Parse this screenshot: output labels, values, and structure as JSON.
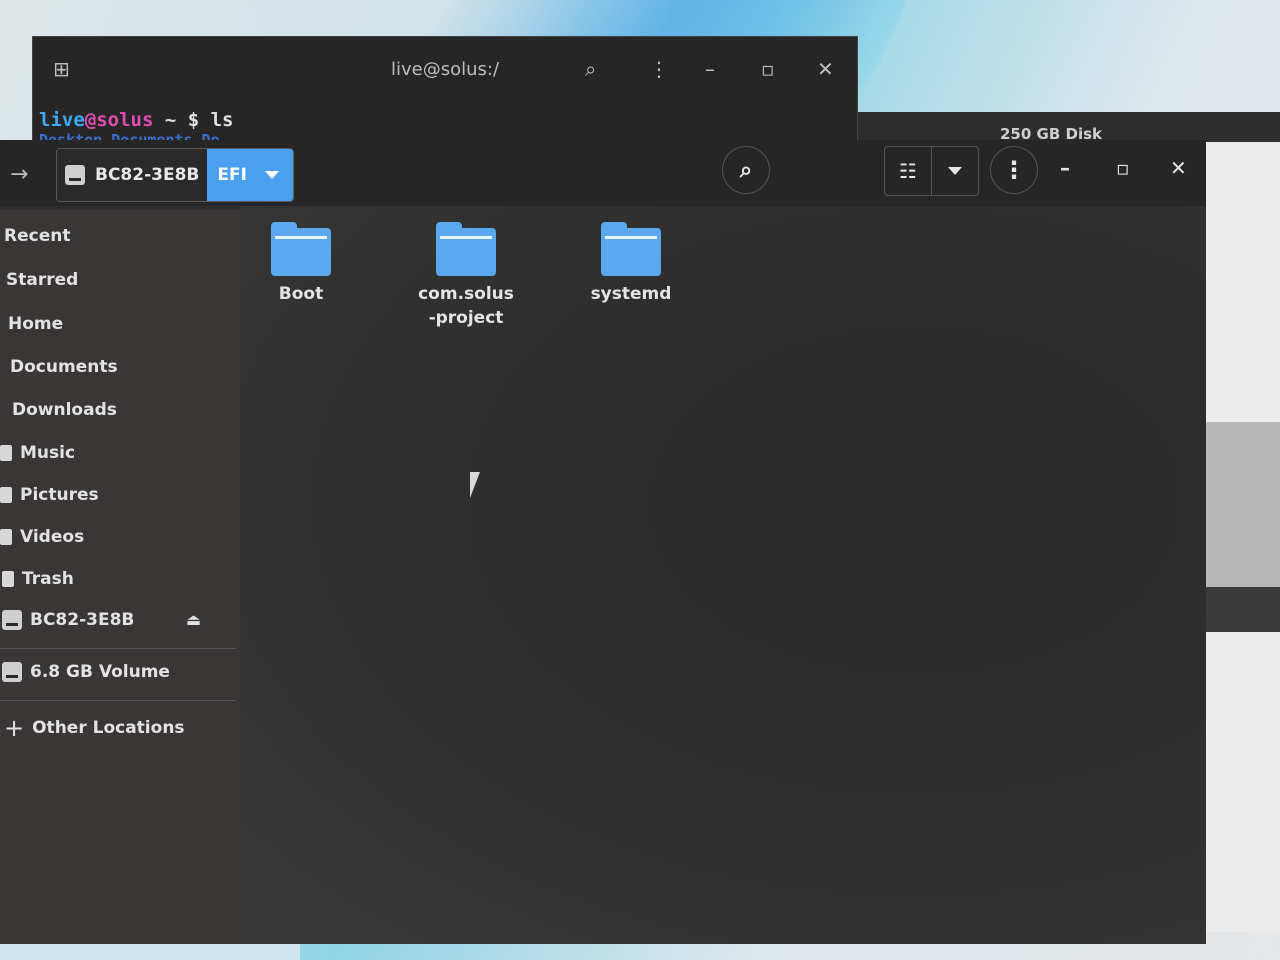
{
  "terminal": {
    "title": "live@solus:/",
    "prompt_user": "live",
    "prompt_at": "@",
    "prompt_host": "solus",
    "prompt_rest": " ~ $ ls",
    "output_partial": "Desktop   Documents   Do..."
  },
  "back_window": {
    "title_partial": "250 GB Disk"
  },
  "file_manager": {
    "path": {
      "device": "BC82-3E8B",
      "current": "EFI"
    },
    "sidebar": [
      {
        "label": "Recent"
      },
      {
        "label": "Starred"
      },
      {
        "label": "Home"
      },
      {
        "label": "Documents"
      },
      {
        "label": "Downloads"
      },
      {
        "label": "Music"
      },
      {
        "label": "Pictures"
      },
      {
        "label": "Videos"
      },
      {
        "label": "Trash"
      },
      {
        "label": "BC82-3E8B"
      },
      {
        "label": "6.8 GB Volume"
      },
      {
        "label": "Other Locations"
      }
    ],
    "folders": [
      {
        "name": "Boot"
      },
      {
        "name": "com.solus-project"
      },
      {
        "name": "systemd"
      }
    ]
  },
  "colors": {
    "accent": "#4a9fee",
    "folder": "#5aa8ee"
  }
}
